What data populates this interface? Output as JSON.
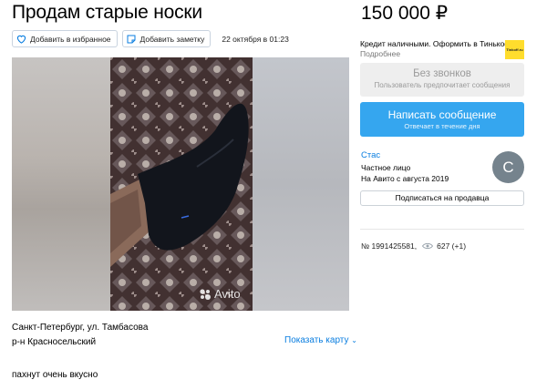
{
  "listing": {
    "title": "Продам старые носки",
    "price": "150 000 ₽",
    "date": "22 октября в 01:23"
  },
  "actions": {
    "favorite_label": "Добавить в избранное",
    "note_label": "Добавить заметку"
  },
  "photo": {
    "watermark": "Avito"
  },
  "location": {
    "address": "Санкт-Петербург, ул. Тамбасова",
    "district": "р-н Красносельский",
    "show_map": "Показать карту"
  },
  "description": "пахнут очень вкусно",
  "credit": {
    "text": "Кредит наличными. Оформить в Тинькофф.",
    "more": "Подробнее",
    "logo_text": "Tinkoff.ru"
  },
  "contact": {
    "no_calls_title": "Без звонков",
    "no_calls_sub": "Пользователь предпочитает сообщения",
    "message_title": "Написать сообщение",
    "message_sub": "Отвечает в течение дня"
  },
  "seller": {
    "name": "Стас",
    "type": "Частное лицо",
    "since": "На Авито с августа 2019",
    "avatar_letter": "С",
    "subscribe_label": "Подписаться на продавца"
  },
  "meta": {
    "number": "№ 1991425581,",
    "views": "627 (+1)"
  },
  "colors": {
    "accent_blue": "#35a6ef",
    "link_blue": "#0a7ee0",
    "tinkoff_yellow": "#ffdd2d"
  }
}
